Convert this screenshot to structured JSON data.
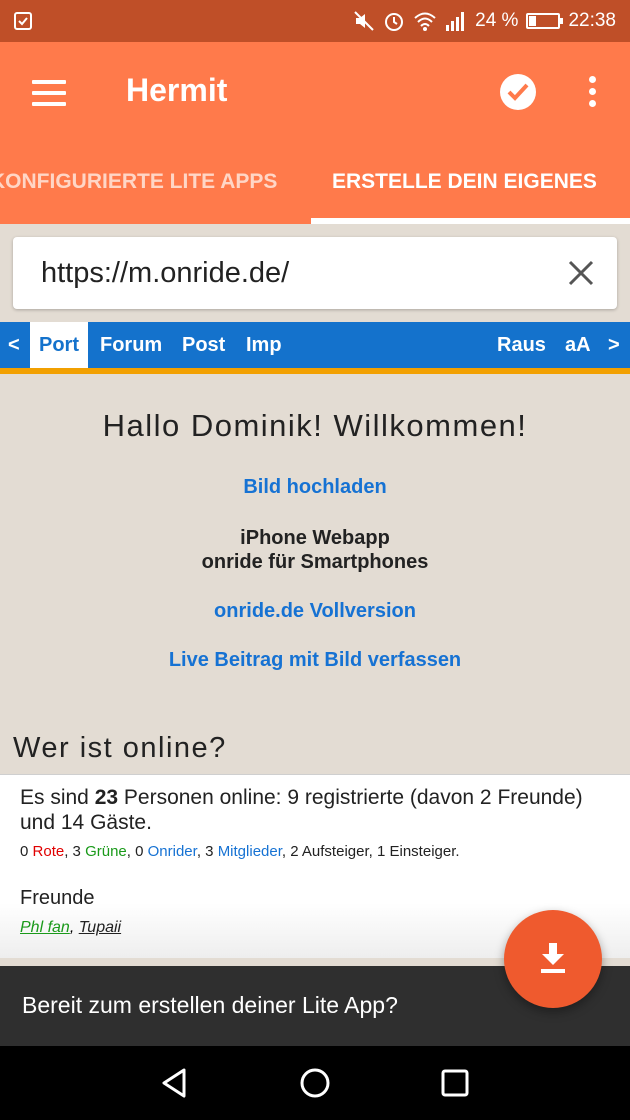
{
  "status_bar": {
    "signal": "24 %",
    "time": "22:38",
    "battery_level": 0.24,
    "icons": [
      "checkbox-notification-icon",
      "mute-icon",
      "alarm-icon",
      "wifi-icon",
      "signal-icon",
      "battery-icon"
    ]
  },
  "app_bar": {
    "title": "Hermit",
    "icons": [
      "menu-icon",
      "check-circle-icon",
      "more-vert-icon"
    ]
  },
  "tabs": [
    {
      "label": "KONFIGURIERTE LITE APPS",
      "selected": false
    },
    {
      "label": "ERSTELLE DEIN EIGENES",
      "selected": true
    }
  ],
  "url_field": {
    "value": "https://m.onride.de/"
  },
  "site_nav": {
    "items": [
      "<",
      "Port",
      "Forum",
      "Post",
      "Imp",
      "Raus",
      "aA",
      ">"
    ],
    "active": "Port"
  },
  "page": {
    "welcome": "Hallo Dominik! Willkommen!",
    "upload_link": "Bild hochladen",
    "webapp_line1": "iPhone Webapp",
    "webapp_line2": "onride für Smartphones",
    "full_version_link": "onride.de Vollversion",
    "live_post_link": "Live Beitrag mit Bild verfassen",
    "online_title": "Wer ist online?"
  },
  "online": {
    "prefix": "Es sind ",
    "count": "23",
    "suffix": " Personen online: 9 registrierte (davon 2 Freunde) und 14 Gäste.",
    "groups": [
      {
        "count": "0",
        "name": "Rote",
        "color": "#e00000"
      },
      {
        "count": "3",
        "name": "Grüne",
        "color": "#1a9a1a"
      },
      {
        "count": "0",
        "name": "Onrider",
        "color": "#1672d3"
      },
      {
        "count": "3",
        "name": "Mitglieder",
        "color": "#1672d3"
      },
      {
        "count": "2",
        "name": "Aufsteiger",
        "color": "#222222"
      },
      {
        "count": "1",
        "name": "Einsteiger",
        "color": "#222222"
      }
    ],
    "friends_title": "Freunde",
    "friends": [
      "Phl fan",
      "Tupaii"
    ]
  },
  "snackbar": {
    "text": "Bereit zum erstellen deiner Lite App?"
  },
  "fab": {
    "icon": "download-icon"
  },
  "colors": {
    "primary": "#ff7a4b",
    "status_bar": "#bf4f28",
    "fab": "#ef5a2e",
    "site_nav": "#1472cc",
    "site_nav_border": "#f2a000",
    "page_background": "#e3dcd3",
    "link": "#1672d3"
  }
}
